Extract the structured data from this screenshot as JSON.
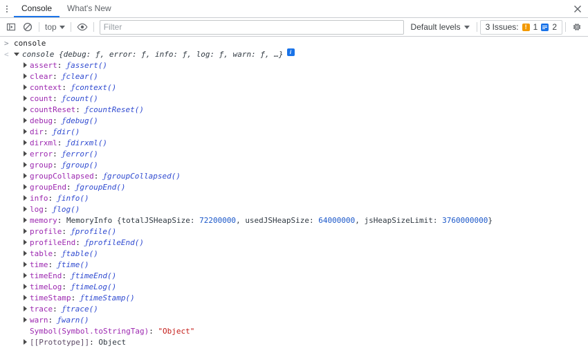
{
  "window": {
    "close_label": "✕"
  },
  "tabs": [
    {
      "label": "Console",
      "active": true
    },
    {
      "label": "What's New",
      "active": false
    }
  ],
  "toolbar": {
    "sidebar_toggle_icon": "console-sidebar-icon",
    "clear_icon": "clear-console-icon",
    "context_label": "top",
    "eye_icon": "live-expression-eye-icon",
    "filter_placeholder": "Filter",
    "filter_value": "",
    "levels_label": "Default levels",
    "issues_label": "3 Issues:",
    "issues_warning_count": "1",
    "issues_info_count": "2",
    "settings_icon": "gear-icon"
  },
  "console": {
    "prompt_marker": ">",
    "result_marker": "<",
    "input_expression": "console",
    "result_preview_name": "console",
    "result_preview_body": "{debug: ƒ, error: ƒ, info: ƒ, log: ƒ, warn: ƒ, …}",
    "info_chip_label": "i",
    "properties": [
      {
        "name": "assert",
        "kind": "function",
        "value": "assert()",
        "expandable": true
      },
      {
        "name": "clear",
        "kind": "function",
        "value": "clear()",
        "expandable": true
      },
      {
        "name": "context",
        "kind": "function",
        "value": "context()",
        "expandable": true
      },
      {
        "name": "count",
        "kind": "function",
        "value": "count()",
        "expandable": true
      },
      {
        "name": "countReset",
        "kind": "function",
        "value": "countReset()",
        "expandable": true
      },
      {
        "name": "debug",
        "kind": "function",
        "value": "debug()",
        "expandable": true
      },
      {
        "name": "dir",
        "kind": "function",
        "value": "dir()",
        "expandable": true
      },
      {
        "name": "dirxml",
        "kind": "function",
        "value": "dirxml()",
        "expandable": true
      },
      {
        "name": "error",
        "kind": "function",
        "value": "error()",
        "expandable": true
      },
      {
        "name": "group",
        "kind": "function",
        "value": "group()",
        "expandable": true
      },
      {
        "name": "groupCollapsed",
        "kind": "function",
        "value": "groupCollapsed()",
        "expandable": true
      },
      {
        "name": "groupEnd",
        "kind": "function",
        "value": "groupEnd()",
        "expandable": true
      },
      {
        "name": "info",
        "kind": "function",
        "value": "info()",
        "expandable": true
      },
      {
        "name": "log",
        "kind": "function",
        "value": "log()",
        "expandable": true
      },
      {
        "name": "memory",
        "kind": "memory",
        "expandable": true,
        "class_name": "MemoryInfo",
        "fields": [
          {
            "key": "totalJSHeapSize",
            "value": "72200000"
          },
          {
            "key": "usedJSHeapSize",
            "value": "64000000"
          },
          {
            "key": "jsHeapSizeLimit",
            "value": "3760000000"
          }
        ]
      },
      {
        "name": "profile",
        "kind": "function",
        "value": "profile()",
        "expandable": true
      },
      {
        "name": "profileEnd",
        "kind": "function",
        "value": "profileEnd()",
        "expandable": true
      },
      {
        "name": "table",
        "kind": "function",
        "value": "table()",
        "expandable": true
      },
      {
        "name": "time",
        "kind": "function",
        "value": "time()",
        "expandable": true
      },
      {
        "name": "timeEnd",
        "kind": "function",
        "value": "timeEnd()",
        "expandable": true
      },
      {
        "name": "timeLog",
        "kind": "function",
        "value": "timeLog()",
        "expandable": true
      },
      {
        "name": "timeStamp",
        "kind": "function",
        "value": "timeStamp()",
        "expandable": true
      },
      {
        "name": "trace",
        "kind": "function",
        "value": "trace()",
        "expandable": true
      },
      {
        "name": "warn",
        "kind": "function",
        "value": "warn()",
        "expandable": true
      },
      {
        "name": "Symbol(Symbol.toStringTag)",
        "kind": "string",
        "value": "\"Object\"",
        "expandable": false
      },
      {
        "name": "[[Prototype]]",
        "kind": "object",
        "value": "Object",
        "expandable": true
      }
    ]
  },
  "colors": {
    "accent": "#1a73e8",
    "property_name": "#9c27b0",
    "function_value": "#2f4ad0",
    "number_value": "#1a57c9",
    "string_value": "#c41a16",
    "warning_badge": "#f29900"
  }
}
